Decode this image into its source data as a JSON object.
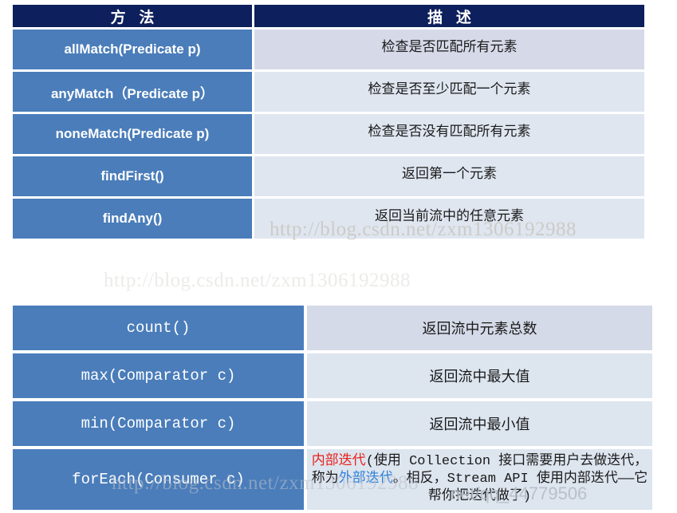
{
  "table1": {
    "headers": [
      "方  法",
      "描  述"
    ],
    "rows": [
      {
        "method": "allMatch(Predicate p)",
        "desc": "检查是否匹配所有元素"
      },
      {
        "method": "anyMatch（Predicate p）",
        "desc": "检查是否至少匹配一个元素"
      },
      {
        "method": "noneMatch(Predicate  p)",
        "desc": "检查是否没有匹配所有元素"
      },
      {
        "method": "findFirst()",
        "desc": "返回第一个元素"
      },
      {
        "method": "findAny()",
        "desc": "返回当前流中的任意元素"
      }
    ]
  },
  "table2": {
    "rows": [
      {
        "method": "count()",
        "desc": "返回流中元素总数"
      },
      {
        "method": "max(Comparator c)",
        "desc": "返回流中最大值"
      },
      {
        "method": "min(Comparator c)",
        "desc": "返回流中最小值"
      },
      {
        "method": "forEach(Consumer c)",
        "desc_parts": {
          "p1": "内部迭代",
          "p2": "(使用 Collection 接口需要用户去做迭代，称为",
          "p3": "外部迭代",
          "p4": "。相反，Stream API 使用内部迭代——它帮你把迭代做了)"
        }
      }
    ]
  },
  "watermarks": {
    "csdn_blog": "http://blog.csdn.net/zxm1306192988",
    "csdn_blog_2": "http://blog.csdn.net/zxm1306192988",
    "csdn_blog_3": "http://blog.csdn.net/zxm1306192988",
    "qq_user": "net/qq_44779506"
  },
  "colors": {
    "header_navy": "#0d1f5c",
    "method_blue": "#4a7dba",
    "desc_light": "#dfe6f0",
    "desc_light_alt": "#d6dae8",
    "accent_red": "#e8211b",
    "accent_blue": "#2b7fd6"
  }
}
